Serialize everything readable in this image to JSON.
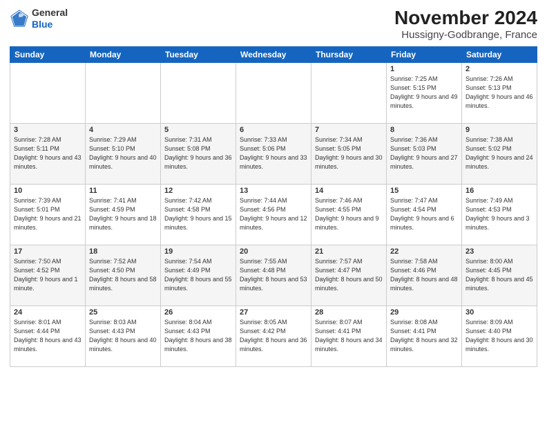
{
  "logo": {
    "general": "General",
    "blue": "Blue"
  },
  "header": {
    "month": "November 2024",
    "location": "Hussigny-Godbrange, France"
  },
  "weekdays": [
    "Sunday",
    "Monday",
    "Tuesday",
    "Wednesday",
    "Thursday",
    "Friday",
    "Saturday"
  ],
  "weeks": [
    [
      {
        "day": "",
        "info": ""
      },
      {
        "day": "",
        "info": ""
      },
      {
        "day": "",
        "info": ""
      },
      {
        "day": "",
        "info": ""
      },
      {
        "day": "",
        "info": ""
      },
      {
        "day": "1",
        "info": "Sunrise: 7:25 AM\nSunset: 5:15 PM\nDaylight: 9 hours and 49 minutes."
      },
      {
        "day": "2",
        "info": "Sunrise: 7:26 AM\nSunset: 5:13 PM\nDaylight: 9 hours and 46 minutes."
      }
    ],
    [
      {
        "day": "3",
        "info": "Sunrise: 7:28 AM\nSunset: 5:11 PM\nDaylight: 9 hours and 43 minutes."
      },
      {
        "day": "4",
        "info": "Sunrise: 7:29 AM\nSunset: 5:10 PM\nDaylight: 9 hours and 40 minutes."
      },
      {
        "day": "5",
        "info": "Sunrise: 7:31 AM\nSunset: 5:08 PM\nDaylight: 9 hours and 36 minutes."
      },
      {
        "day": "6",
        "info": "Sunrise: 7:33 AM\nSunset: 5:06 PM\nDaylight: 9 hours and 33 minutes."
      },
      {
        "day": "7",
        "info": "Sunrise: 7:34 AM\nSunset: 5:05 PM\nDaylight: 9 hours and 30 minutes."
      },
      {
        "day": "8",
        "info": "Sunrise: 7:36 AM\nSunset: 5:03 PM\nDaylight: 9 hours and 27 minutes."
      },
      {
        "day": "9",
        "info": "Sunrise: 7:38 AM\nSunset: 5:02 PM\nDaylight: 9 hours and 24 minutes."
      }
    ],
    [
      {
        "day": "10",
        "info": "Sunrise: 7:39 AM\nSunset: 5:01 PM\nDaylight: 9 hours and 21 minutes."
      },
      {
        "day": "11",
        "info": "Sunrise: 7:41 AM\nSunset: 4:59 PM\nDaylight: 9 hours and 18 minutes."
      },
      {
        "day": "12",
        "info": "Sunrise: 7:42 AM\nSunset: 4:58 PM\nDaylight: 9 hours and 15 minutes."
      },
      {
        "day": "13",
        "info": "Sunrise: 7:44 AM\nSunset: 4:56 PM\nDaylight: 9 hours and 12 minutes."
      },
      {
        "day": "14",
        "info": "Sunrise: 7:46 AM\nSunset: 4:55 PM\nDaylight: 9 hours and 9 minutes."
      },
      {
        "day": "15",
        "info": "Sunrise: 7:47 AM\nSunset: 4:54 PM\nDaylight: 9 hours and 6 minutes."
      },
      {
        "day": "16",
        "info": "Sunrise: 7:49 AM\nSunset: 4:53 PM\nDaylight: 9 hours and 3 minutes."
      }
    ],
    [
      {
        "day": "17",
        "info": "Sunrise: 7:50 AM\nSunset: 4:52 PM\nDaylight: 9 hours and 1 minute."
      },
      {
        "day": "18",
        "info": "Sunrise: 7:52 AM\nSunset: 4:50 PM\nDaylight: 8 hours and 58 minutes."
      },
      {
        "day": "19",
        "info": "Sunrise: 7:54 AM\nSunset: 4:49 PM\nDaylight: 8 hours and 55 minutes."
      },
      {
        "day": "20",
        "info": "Sunrise: 7:55 AM\nSunset: 4:48 PM\nDaylight: 8 hours and 53 minutes."
      },
      {
        "day": "21",
        "info": "Sunrise: 7:57 AM\nSunset: 4:47 PM\nDaylight: 8 hours and 50 minutes."
      },
      {
        "day": "22",
        "info": "Sunrise: 7:58 AM\nSunset: 4:46 PM\nDaylight: 8 hours and 48 minutes."
      },
      {
        "day": "23",
        "info": "Sunrise: 8:00 AM\nSunset: 4:45 PM\nDaylight: 8 hours and 45 minutes."
      }
    ],
    [
      {
        "day": "24",
        "info": "Sunrise: 8:01 AM\nSunset: 4:44 PM\nDaylight: 8 hours and 43 minutes."
      },
      {
        "day": "25",
        "info": "Sunrise: 8:03 AM\nSunset: 4:43 PM\nDaylight: 8 hours and 40 minutes."
      },
      {
        "day": "26",
        "info": "Sunrise: 8:04 AM\nSunset: 4:43 PM\nDaylight: 8 hours and 38 minutes."
      },
      {
        "day": "27",
        "info": "Sunrise: 8:05 AM\nSunset: 4:42 PM\nDaylight: 8 hours and 36 minutes."
      },
      {
        "day": "28",
        "info": "Sunrise: 8:07 AM\nSunset: 4:41 PM\nDaylight: 8 hours and 34 minutes."
      },
      {
        "day": "29",
        "info": "Sunrise: 8:08 AM\nSunset: 4:41 PM\nDaylight: 8 hours and 32 minutes."
      },
      {
        "day": "30",
        "info": "Sunrise: 8:09 AM\nSunset: 4:40 PM\nDaylight: 8 hours and 30 minutes."
      }
    ]
  ]
}
